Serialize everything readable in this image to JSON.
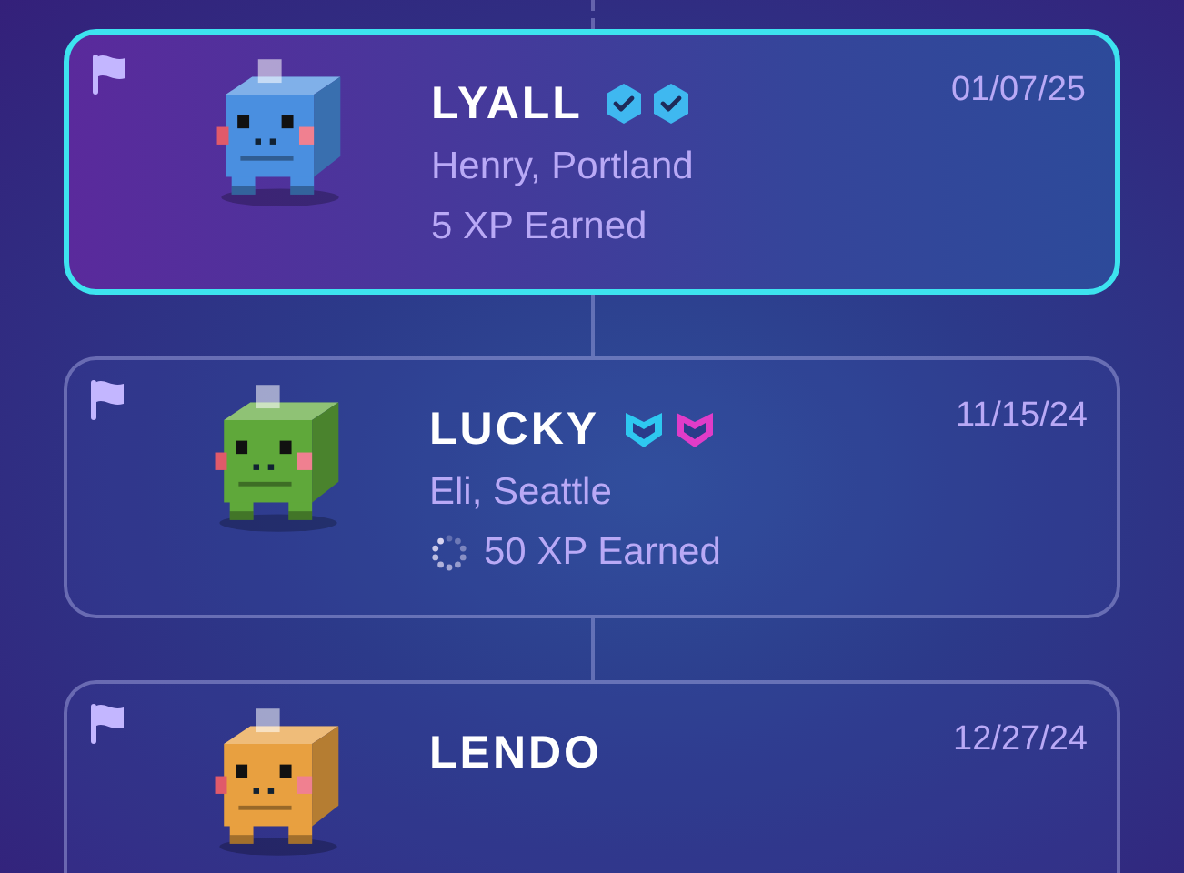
{
  "entries": [
    {
      "name": "LYALL",
      "badges": [
        {
          "kind": "check",
          "color": "#3fb8f0"
        },
        {
          "kind": "check",
          "color": "#3fb8f0"
        }
      ],
      "date": "01/07/25",
      "location": "Henry, Portland",
      "xp": "5 XP Earned",
      "pending": false,
      "selected": true,
      "color": "#4a8fe0"
    },
    {
      "name": "LUCKY",
      "badges": [
        {
          "kind": "heart",
          "color": "#2ec8f0"
        },
        {
          "kind": "heart",
          "color": "#e03cc8"
        }
      ],
      "date": "11/15/24",
      "location": "Eli, Seattle",
      "xp": "50 XP Earned",
      "pending": true,
      "selected": false,
      "color": "#5fa83a"
    },
    {
      "name": "LENDO",
      "date": "12/27/24",
      "selected": false,
      "color": "#e8a040"
    }
  ]
}
